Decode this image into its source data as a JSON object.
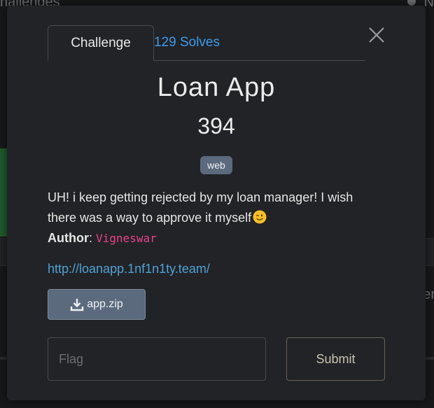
{
  "background": {
    "top_left_text": "hallenges",
    "top_right_text": "N",
    "mid_right_text": "er"
  },
  "modal": {
    "tabs": [
      {
        "label": "Challenge",
        "active": true
      },
      {
        "label": "129 Solves",
        "active": false
      }
    ],
    "close_icon": "close-icon"
  },
  "challenge": {
    "name": "Loan App",
    "points": "394",
    "category_tag": "web",
    "description": "UH! i keep getting rejected by my loan manager! I wish there was a way to approve it myself",
    "description_emoji": "winking-face",
    "author_label": "Author",
    "author_sep": ":",
    "author_name": "Vigneswar",
    "link": "http://loanapp.1nf1n1ty.team/",
    "file": {
      "name": "app.zip",
      "icon": "download-icon"
    }
  },
  "submission": {
    "flag_placeholder": "Flag",
    "flag_value": "",
    "submit_label": "Submit"
  },
  "colors": {
    "accent": "#3d9be9",
    "link": "#4ea2d6",
    "author": "#e8438d",
    "badge": "#5b6a7d",
    "modal_bg": "#222326"
  }
}
